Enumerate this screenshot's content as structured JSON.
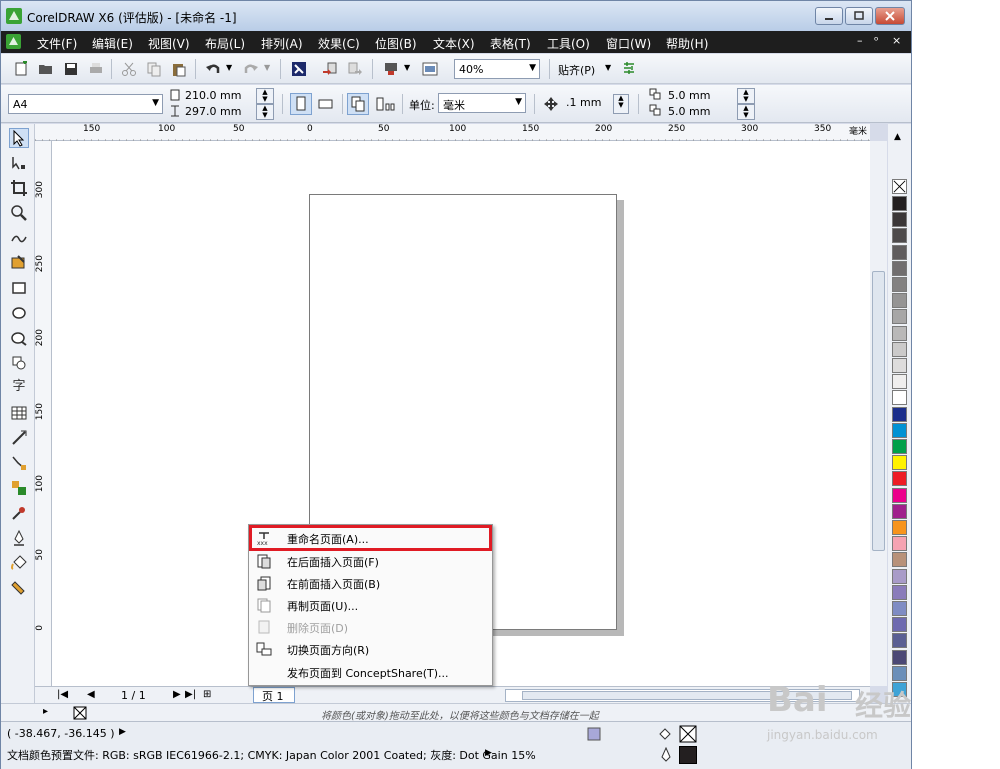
{
  "window": {
    "title": "CorelDRAW X6 (评估版) - [未命名 -1]"
  },
  "menubar": {
    "items": [
      "文件(F)",
      "编辑(E)",
      "视图(V)",
      "布局(L)",
      "排列(A)",
      "效果(C)",
      "位图(B)",
      "文本(X)",
      "表格(T)",
      "工具(O)",
      "窗口(W)",
      "帮助(H)"
    ],
    "controls": [
      "–",
      "ᵒ",
      "×"
    ]
  },
  "toolbar1": {
    "zoom_value": "40%",
    "snap_label": "贴齐(P)"
  },
  "toolbar2": {
    "paper_size": "A4",
    "width": "210.0 mm",
    "height": "297.0 mm",
    "units_label": "单位:",
    "units_value": "毫米",
    "nudge": ".1 mm",
    "dup_x": "5.0 mm",
    "dup_y": "5.0 mm"
  },
  "ruler": {
    "h_ticks": [
      "150",
      "100",
      "50",
      "0",
      "50",
      "100",
      "150",
      "200",
      "250",
      "300",
      "350"
    ],
    "h_unit": "毫米",
    "v_ticks": [
      "300",
      "250",
      "200",
      "150",
      "100",
      "50",
      "0"
    ]
  },
  "toolbox": {
    "text_tool": "字"
  },
  "pagebar": {
    "page_count": "1 / 1",
    "page_tab": "页 1"
  },
  "hint": "将颜色(或对象)拖动至此处，以便将这些颜色与文档存储在一起",
  "status": {
    "coords": "( -38.467, -36.145 )",
    "profile": "文档颜色预置文件: RGB: sRGB IEC61966-2.1; CMYK: Japan Color 2001 Coated; 灰度: Dot Gain 15%"
  },
  "context_menu": {
    "items": [
      {
        "label": "重命名页面(A)...",
        "enabled": true,
        "highlighted": true
      },
      {
        "label": "在后面插入页面(F)",
        "enabled": true
      },
      {
        "label": "在前面插入页面(B)",
        "enabled": true
      },
      {
        "label": "再制页面(U)...",
        "enabled": true
      },
      {
        "label": "删除页面(D)",
        "enabled": false
      },
      {
        "label": "切换页面方向(R)",
        "enabled": true
      },
      {
        "label": "发布页面到 ConceptShare(T)...",
        "enabled": true
      }
    ]
  },
  "palette": {
    "colors": [
      "#231f20",
      "#3a3637",
      "#4d4a4b",
      "#5f5c5d",
      "#716e6f",
      "#838181",
      "#959494",
      "#a7a6a6",
      "#b9b8b8",
      "#cbcaca",
      "#dddcdc",
      "#efeeee",
      "#ffffff",
      "#1b2e8c",
      "#0092d4",
      "#00a04a",
      "#fff200",
      "#ed1c24",
      "#ec008c",
      "#a0218c",
      "#f7941d",
      "#f5a3b2",
      "#b8927a",
      "#a89bc8",
      "#8a7cba",
      "#7f8cc4",
      "#6e6ab0",
      "#5a5f93",
      "#4b4875",
      "#6b8fb9",
      "#3fa3d6"
    ]
  },
  "watermark": {
    "brand": "Bai",
    "brand_cn": "经验",
    "url": "jingyan.baidu.com"
  }
}
